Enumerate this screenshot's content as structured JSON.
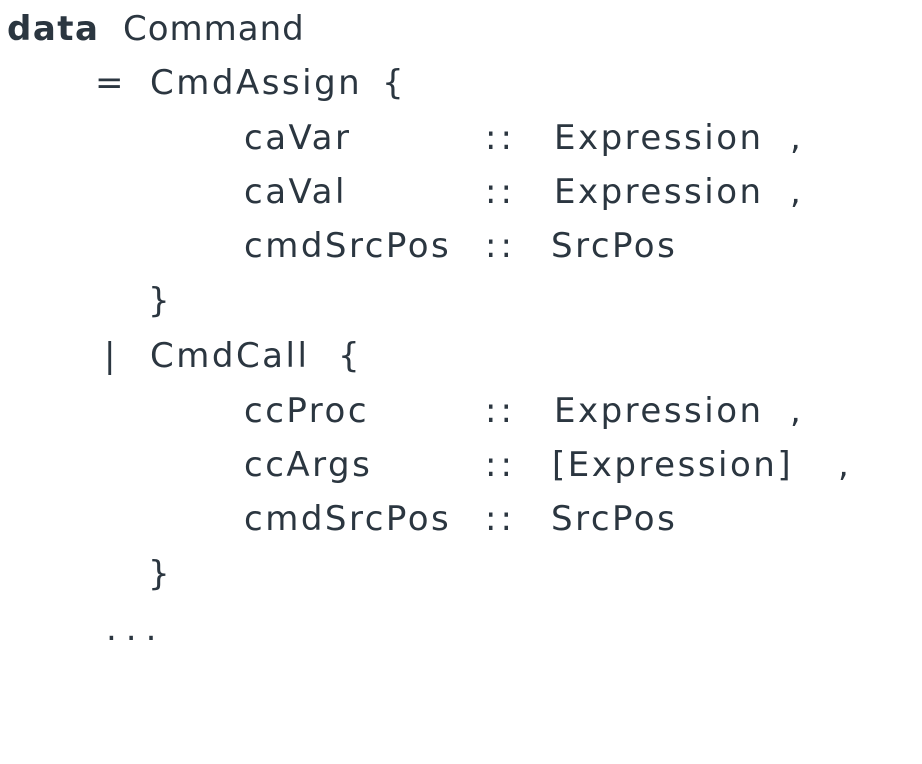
{
  "decl": {
    "keyword": "data",
    "type_name": "Command"
  },
  "constructors": [
    {
      "separator": "=",
      "name": "CmdAssign",
      "open_brace": "{",
      "close_brace": "}",
      "fields": [
        {
          "name": "caVar",
          "sep": "::",
          "type": "Expression",
          "trail": ","
        },
        {
          "name": "caVal",
          "sep": "::",
          "type": "Expression",
          "trail": ","
        },
        {
          "name": "cmdSrcPos",
          "sep": "::",
          "type": "SrcPos",
          "trail": ""
        }
      ]
    },
    {
      "separator": "|",
      "name": "CmdCall",
      "open_brace": "{",
      "close_brace": "}",
      "fields": [
        {
          "name": "ccProc",
          "sep": "::",
          "type": "Expression",
          "trail": ","
        },
        {
          "name": "ccArgs",
          "sep": "::",
          "type": "[Expression]",
          "trail": ","
        },
        {
          "name": "cmdSrcPos",
          "sep": "::",
          "type": "SrcPos",
          "trail": ""
        }
      ]
    }
  ],
  "ellipsis": "..."
}
